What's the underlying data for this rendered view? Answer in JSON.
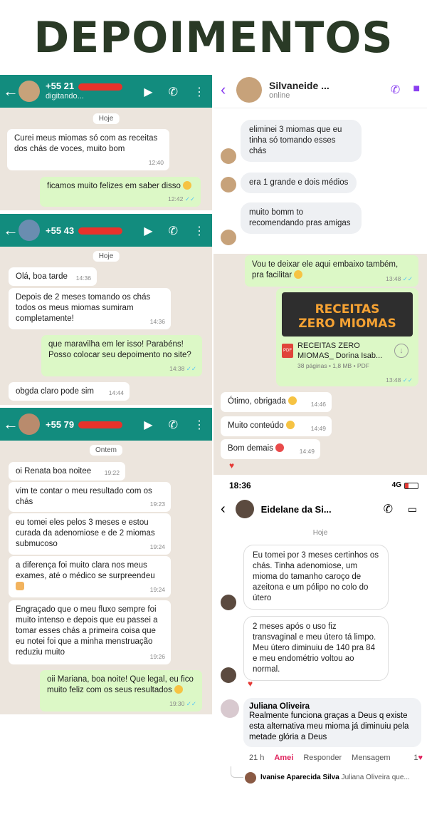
{
  "title": "DEPOIMENTOS",
  "chat1": {
    "phone": "+55 21",
    "status": "digitando...",
    "day": "Hoje",
    "messages": [
      {
        "text": "Curei meus miomas só com as receitas dos chás de voces, muito bom",
        "time": "12:40"
      },
      {
        "text": "ficamos muito felizes em saber disso",
        "time": "12:42"
      }
    ]
  },
  "chat2": {
    "phone": "+55 43",
    "day": "Hoje",
    "messages": [
      {
        "text": "Olá, boa tarde",
        "time": "14:36"
      },
      {
        "text": "Depois de 2 meses tomando os chás todos os meus miomas sumiram completamente!",
        "time": "14:36"
      },
      {
        "text": "que maravilha em ler isso! Parabéns! Posso colocar seu depoimento no site?",
        "time": "14:38"
      },
      {
        "text": "obgda claro pode sim",
        "time": "14:44"
      }
    ]
  },
  "chat3": {
    "phone": "+55 79",
    "day": "Ontem",
    "messages": [
      {
        "text": "oi Renata boa noitee",
        "time": "19:22"
      },
      {
        "text": "vim te contar o meu resultado com os chás",
        "time": "19:23"
      },
      {
        "text": "eu tomei eles pelos 3 meses e estou curada da adenomiose e de 2 miomas submucoso",
        "time": "19:24"
      },
      {
        "text": "a diferença foi muito clara nos meus exames, até o médico se surpreendeu",
        "time": "19:24"
      },
      {
        "text": "Engraçado que o meu fluxo sempre foi muito intenso e depois que eu passei a tomar esses chás a primeira coisa que eu notei foi que a minha menstruação reduziu muito",
        "time": "19:26"
      },
      {
        "text": "oii Mariana, boa noite! Que legal, eu fico muito feliz com os seus resultados",
        "time": "19:30"
      }
    ]
  },
  "chat4": {
    "name": "Silvaneide ...",
    "status": "online",
    "messages": [
      {
        "text": "eliminei 3 miomas que eu tinha só tomando esses chás"
      },
      {
        "text": "era 1 grande e dois médios"
      },
      {
        "text": "muito bomm to recomendando pras amigas"
      }
    ],
    "reply": {
      "text": "Vou te deixar ele aqui embaixo também, pra facilitar",
      "time": "13:48"
    },
    "pdf": {
      "preview_line1": "RECEITAS",
      "preview_line2": "ZERO MIOMAS",
      "name": "RECEITAS ZERO MIOMAS_ Dorina Isab...",
      "meta": "38 páginas • 1,8 MB • PDF",
      "time": "13:48",
      "badge": "PDF"
    },
    "followups": [
      {
        "text": "Ótimo, obrigada",
        "time": "14:46"
      },
      {
        "text": "Muito conteúdo",
        "time": "14:49"
      },
      {
        "text": "Bom demais",
        "time": "14:49"
      }
    ]
  },
  "chat5": {
    "clock": "18:36",
    "network": "4G",
    "name": "Eidelane da Si...",
    "day": "Hoje",
    "messages": [
      {
        "text": "Eu tomei por 3 meses certinhos os chás. Tinha adenomiose, um mioma do tamanho caroço de azeitona e um pólipo no colo do útero"
      },
      {
        "text": "2 meses após o uso fiz transvaginal e meu útero tá limpo. Meu útero diminuiu de 140 pra 84 e meu endométrio voltou ao normal."
      }
    ]
  },
  "fb": {
    "author": "Juliana Oliveira",
    "text": "Realmente funciona graças a Deus q existe esta alternativa meu mioma já diminuiu pela metade glória a Deus",
    "age": "21 h",
    "like": "Amei",
    "reply": "Responder",
    "message": "Mensagem",
    "count": "1",
    "reply_author": "Ivanise Aparecida Silva",
    "reply_preview": "Juliana Oliveira que..."
  }
}
